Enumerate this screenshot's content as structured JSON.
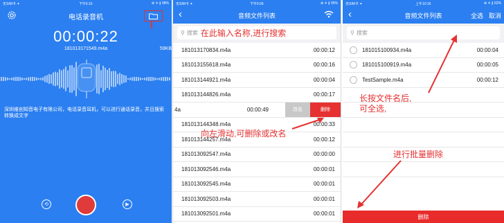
{
  "screen1": {
    "status_left": "无SIM卡 ✦",
    "status_time": "下午5:16",
    "status_right": "⊕ ✈ ∦ 98%",
    "title": "电话录音机",
    "timer": "00:00:22",
    "file_name": "181013171549.m4a",
    "file_size": "59KB",
    "description": "深圳维创知音电子有限公司，电话录音耳机，可以进行通话录音，并且搜索转换成文字"
  },
  "screen2": {
    "status_left": "无SIM卡 ✦",
    "status_time": "下午5:09",
    "status_right": "⊕ ✈ ∦ 95%",
    "title": "音频文件列表",
    "search_placeholder": "搜索",
    "search_annotation": "在此输入名称,进行搜索",
    "swipe_annotation": "向左滑动,可删除或改名",
    "rename_label": "改名",
    "delete_label": "删除",
    "rows_top": [
      {
        "name": "181013170834.m4a",
        "time": "00:00:12"
      },
      {
        "name": "181013155618.m4a",
        "time": "00:00:16"
      },
      {
        "name": "181013144921.m4a",
        "time": "00:00:04"
      },
      {
        "name": "181013144826.m4a",
        "time": "00:00:17"
      }
    ],
    "swipe_row": {
      "name": "4a",
      "time": "00:00:49"
    },
    "rows_bottom": [
      {
        "name": "181013144348.m4a",
        "time": "00:00:33"
      },
      {
        "name": "181013144257.m4a",
        "time": "00:00:12"
      },
      {
        "name": "181013092547.m4a",
        "time": "00:00:00"
      },
      {
        "name": "181013092546.m4a",
        "time": "00:00:01"
      },
      {
        "name": "181013092545.m4a",
        "time": "00:00:01"
      },
      {
        "name": "181013092503.m4a",
        "time": "00:00:01"
      },
      {
        "name": "181013092501.m4a",
        "time": "00:00:01"
      }
    ]
  },
  "screen3": {
    "status_left": "无SIM卡 ✦",
    "status_time": "上午10:16",
    "status_right": "⊕ ✈ ∦ 62%",
    "title": "音频文件列表",
    "select_all": "全选",
    "cancel": "取消",
    "search_placeholder": "搜索",
    "rows": [
      {
        "name": "181015100934.m4a",
        "time": "00:00:04"
      },
      {
        "name": "181015100919.m4a",
        "time": "00:00:05"
      },
      {
        "name": "TestSample.m4a",
        "time": "00:00:12"
      }
    ],
    "annotation_longpress": "长按文件名后,\n可全选,",
    "annotation_batch": "进行批量删除",
    "delete_label": "删除"
  },
  "colors": {
    "blue": "#2b7ff0",
    "red": "#e53131",
    "gray_btn": "#c8c8c8"
  }
}
